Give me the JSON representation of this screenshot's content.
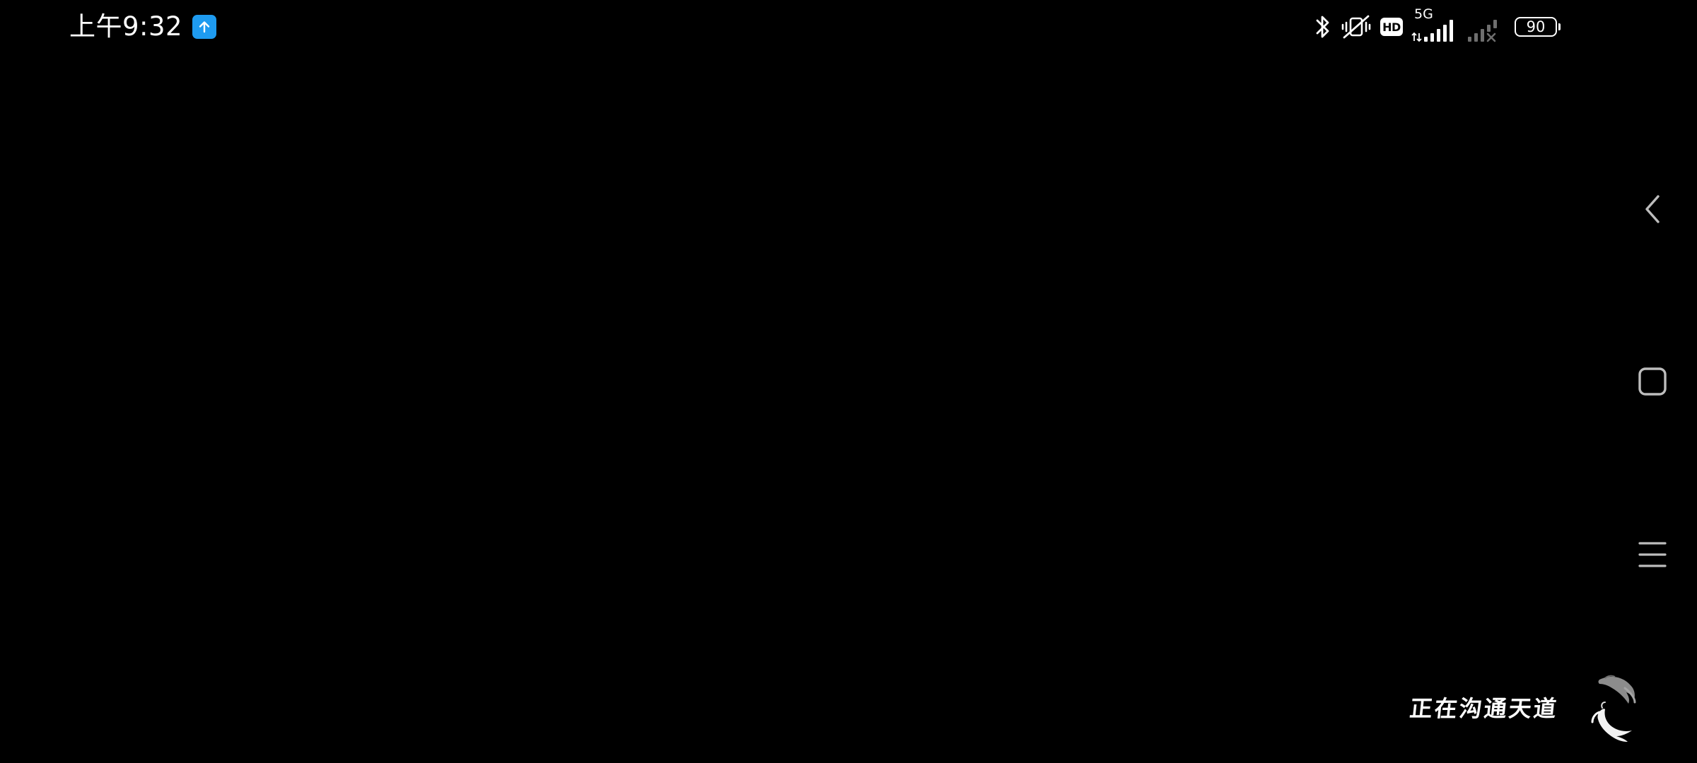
{
  "status_bar": {
    "time": "上午9:32",
    "notification_icon": "upload-arrow-icon",
    "network_type": "5G",
    "hd_label": "HD",
    "battery_level": "90",
    "icons": [
      "bluetooth-icon",
      "vibrate-off-icon",
      "hd-voice-icon",
      "signal-5g-icon",
      "signal-sim2-no-service-icon",
      "battery-icon"
    ],
    "colors": {
      "notification_bg": "#1E9BF0",
      "foreground": "#FFFFFF",
      "dim_signal": "#6E6E6E"
    }
  },
  "nav_bar": {
    "buttons": [
      "back-icon",
      "home-icon",
      "menu-icon"
    ],
    "color": "#BDBDBD"
  },
  "loading": {
    "text": "正在沟通天道",
    "spinner_icon": "koi-fish-spinner-icon"
  },
  "background": "#000000"
}
